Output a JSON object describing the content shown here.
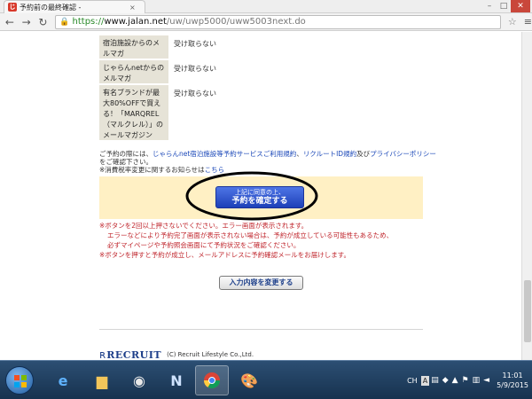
{
  "browser": {
    "tab_title": "予約前の最終確認 - ",
    "tab_close": "×",
    "url_scheme": "https://",
    "url_host": "www.jalan.net",
    "url_path": "/uw/uwp5000/uww5003next.do"
  },
  "options": [
    {
      "label": "宿泊施設からのメルマガ",
      "value": "受け取らない"
    },
    {
      "label": "じゃらんnetからのメルマガ",
      "value": "受け取らない"
    },
    {
      "label": "有名ブランドが最大80%OFFで買える！「MARQREL（マルクレル）」のメールマガジン",
      "value": "受け取らない"
    }
  ],
  "notice": {
    "prefix": "ご予約の際には、",
    "link1": "じゃらんnet宿泊施設等予約サービスご利用規約",
    "sep1": "、",
    "link2": "リクルートID規約",
    "sep2": "及び",
    "link3": "プライバシーポリシー",
    "suffix": "をご確認下さい。",
    "line2_prefix": "※消費税率変更に関するお知らせは",
    "line2_link": "こちら"
  },
  "confirm_button": {
    "small": "上記に同意の上、",
    "big": "予約を確定する"
  },
  "warnings": {
    "line1": "※ボタンを2回以上押さないでください。エラー画面が表示されます。",
    "line2": "エラーなどにより予約完了画面が表示されない場合は、予約が成立している可能性もあるため、",
    "line3": "必ずマイページや予約照会画面にて予約状況をご確認ください。",
    "line4": "※ボタンを押すと予約が成立し、メールアドレスに予約確認メールをお届けします。"
  },
  "change_button": "入力内容を変更する",
  "footer": {
    "logo": "RECRUIT",
    "copyright": "(C) Recruit Lifestyle Co.,Ltd."
  },
  "taskbar": {
    "lang": "CH",
    "time": "11:01",
    "date": "5/9/2015"
  },
  "colors": {
    "confirm_band": "#fff0c4",
    "confirm_button": "#2a4fd0",
    "warning_text": "#c0262d",
    "link": "#1a47b8"
  }
}
